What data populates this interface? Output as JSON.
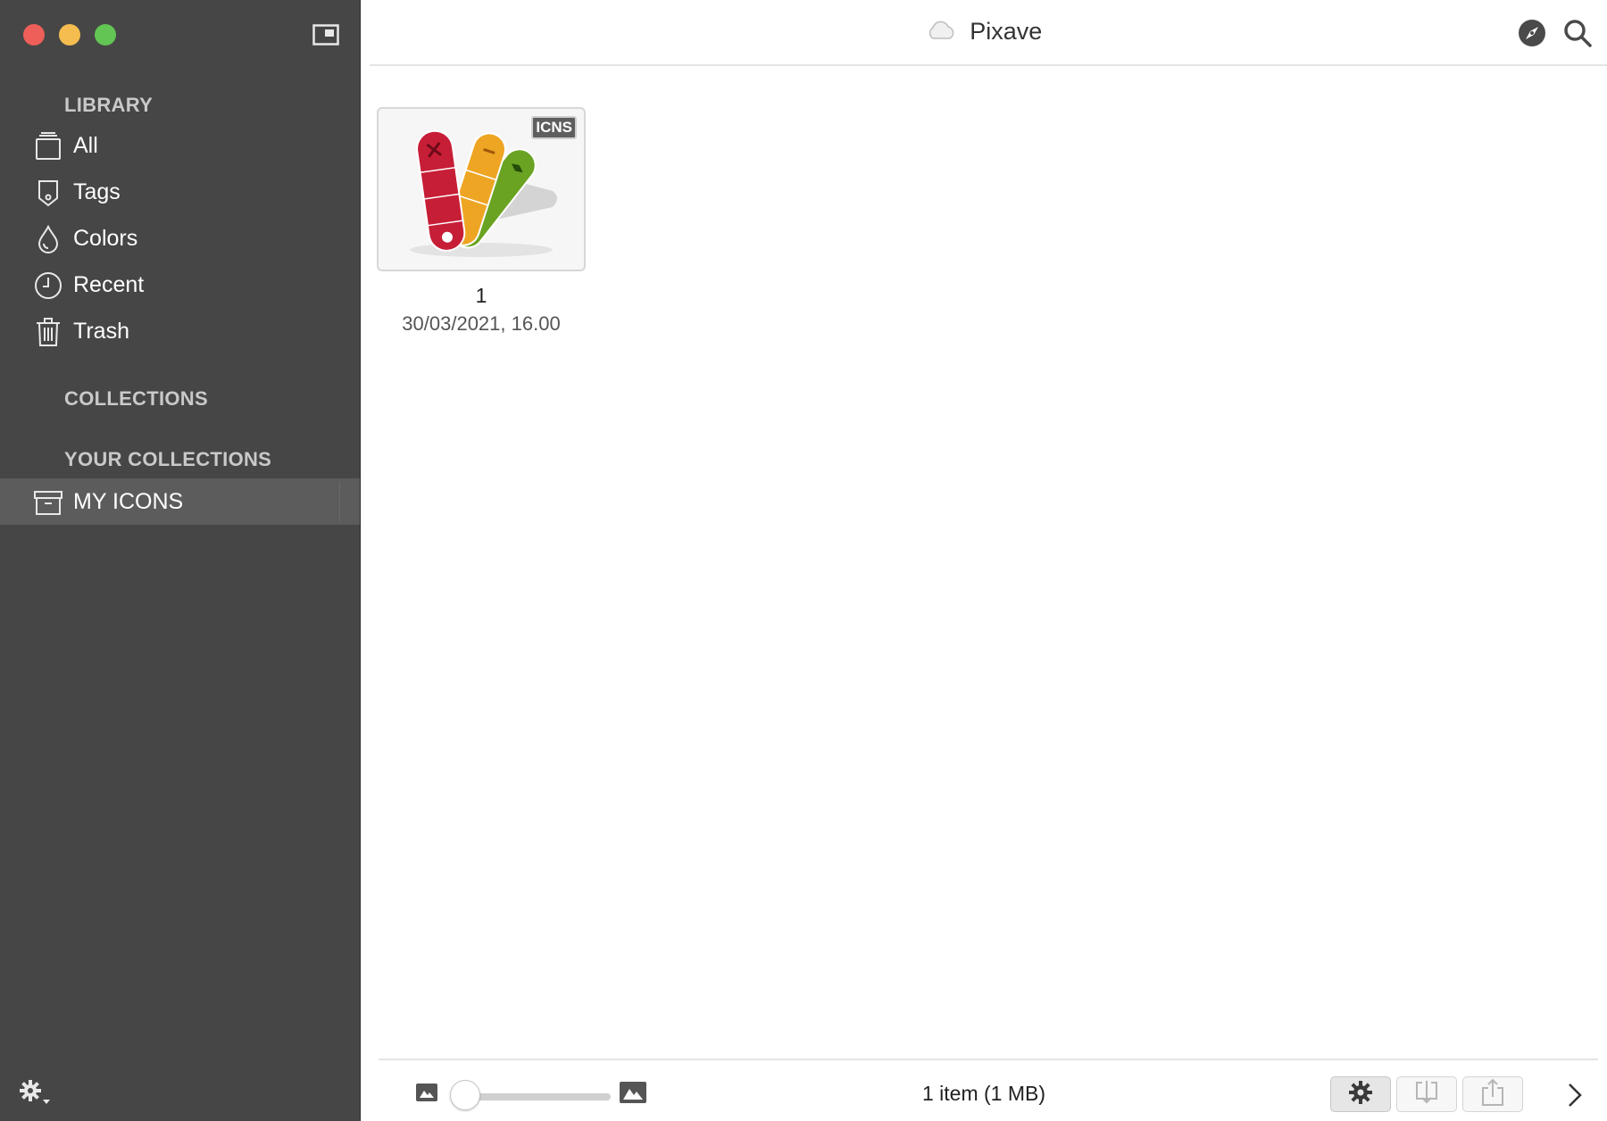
{
  "app": {
    "title": "Pixave"
  },
  "sidebar": {
    "library_header": "LIBRARY",
    "items": [
      {
        "label": "All",
        "icon": "tray-icon"
      },
      {
        "label": "Tags",
        "icon": "tag-icon"
      },
      {
        "label": "Colors",
        "icon": "drop-icon"
      },
      {
        "label": "Recent",
        "icon": "clock-icon"
      },
      {
        "label": "Trash",
        "icon": "trash-icon"
      }
    ],
    "collections_header": "COLLECTIONS",
    "your_collections_header": "YOUR COLLECTIONS",
    "collections": [
      {
        "label": "MY ICONS",
        "icon": "archive-box-icon",
        "selected": true
      }
    ]
  },
  "grid": {
    "items": [
      {
        "name": "1",
        "date": "30/03/2021, 16.00",
        "badge": "ICNS"
      }
    ]
  },
  "footer": {
    "status": "1 item (1 MB)",
    "thumbnail_size": 0.0
  },
  "colors": {
    "sidebar_bg": "#464646",
    "traffic_red": "#ee5f59",
    "traffic_yellow": "#f5bd4f",
    "traffic_green": "#62c554"
  }
}
